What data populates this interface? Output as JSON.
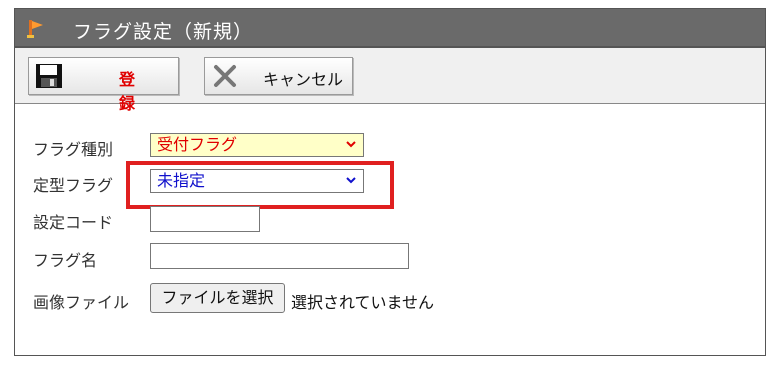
{
  "window": {
    "title": "フラグ設定（新規）"
  },
  "toolbar": {
    "save_label": "登 録",
    "cancel_label": "キャンセル"
  },
  "form": {
    "kind_label": "フラグ種別",
    "kind_value": "受付フラグ",
    "type_label": "定型フラグ",
    "type_value": "未指定",
    "code_label": "設定コード",
    "code_value": "",
    "name_label": "フラグ名",
    "name_value": "",
    "image_label": "画像ファイル",
    "file_button": "ファイルを選択",
    "file_status": "選択されていません"
  },
  "icons": {
    "title": "flag-icon",
    "save": "floppy-disk-icon",
    "cancel": "close-x-icon",
    "dropdown": "chevron-down-icon"
  },
  "colors": {
    "titlebar": "#6a6a6a",
    "save_text": "#e00000",
    "kind_select_bg": "#ffffc8",
    "kind_select_text": "#e00000",
    "type_select_text": "#1010cc",
    "highlight": "#e02020"
  }
}
